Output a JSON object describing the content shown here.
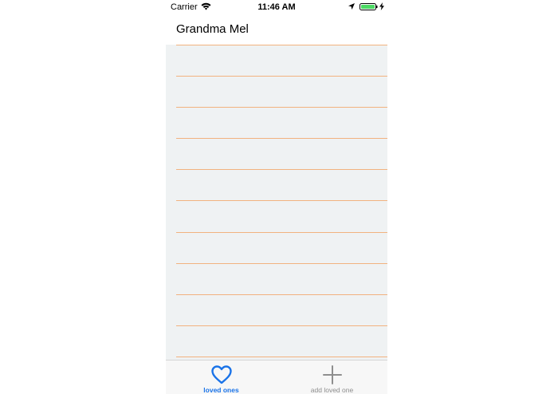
{
  "status_bar": {
    "carrier": "Carrier",
    "time": "11:46 AM",
    "battery_color": "#4cd964"
  },
  "header": {
    "title": "Grandma Mel"
  },
  "list": {
    "row_count": 10,
    "separator_color": "#f2b27f",
    "background_color": "#eff2f3"
  },
  "tab_bar": {
    "tabs": [
      {
        "label": "loved ones",
        "icon": "heart-icon",
        "active": true,
        "color": "#1a73e8"
      },
      {
        "label": "add loved one",
        "icon": "plus-icon",
        "active": false,
        "color": "#8e8e8e"
      }
    ]
  }
}
